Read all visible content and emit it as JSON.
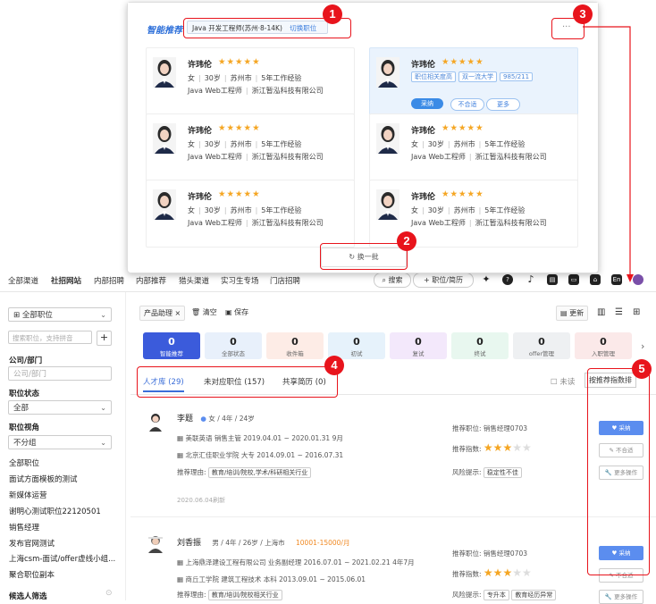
{
  "popup": {
    "brand": "智能推荐",
    "job_selector": "Java 开发工程师(苏州·8-14K)",
    "switch_job": "切换职位",
    "more": "···",
    "refresh": "换一批",
    "cards": [
      {
        "name": "许玮伦",
        "stars": "★★★★★",
        "line1": [
          "女",
          "30岁",
          "苏州市",
          "5年工作经验"
        ],
        "line2": [
          "Java Web工程师",
          "浙江暂泓科技有限公司"
        ]
      },
      {
        "name": "许玮伦",
        "stars": "★★★★★",
        "tags": [
          "职位相关度高",
          "双一流大学",
          "985/211"
        ],
        "actions": [
          "采纳",
          "不合适",
          "更多"
        ]
      },
      {
        "name": "许玮伦",
        "stars": "★★★★★",
        "line1": [
          "女",
          "30岁",
          "苏州市",
          "5年工作经验"
        ],
        "line2": [
          "Java Web工程师",
          "浙江暂泓科技有限公司"
        ]
      },
      {
        "name": "许玮伦",
        "stars": "★★★★★",
        "line1": [
          "女",
          "30岁",
          "苏州市",
          "5年工作经验"
        ],
        "line2": [
          "Java Web工程师",
          "浙江暂泓科技有限公司"
        ]
      },
      {
        "name": "许玮伦",
        "stars": "★★★★★",
        "line1": [
          "女",
          "30岁",
          "苏州市",
          "5年工作经验"
        ],
        "line2": [
          "Java Web工程师",
          "浙江暂泓科技有限公司"
        ]
      },
      {
        "name": "许玮伦",
        "stars": "★★★★★",
        "line1": [
          "女",
          "30岁",
          "苏州市",
          "5年工作经验"
        ],
        "line2": [
          "Java Web工程师",
          "浙江暂泓科技有限公司"
        ]
      }
    ]
  },
  "callouts": [
    "1",
    "2",
    "3",
    "4",
    "5"
  ],
  "nav": {
    "items": [
      "全部渠道",
      "社招网站",
      "内部招聘",
      "内部推荐",
      "猎头渠道",
      "实习生专场",
      "门店招聘"
    ],
    "search": "搜索",
    "post_job": "+ 职位/简历",
    "lang": "En"
  },
  "sidebar": {
    "all_jobs": "全部职位",
    "search_placeholder": "搜索职位，支持拼音",
    "plus": "+",
    "dept_label": "公司/部门",
    "dept_placeholder": "公司/部门",
    "status_label": "职位状态",
    "status_value": "全部",
    "view_label": "职位视角",
    "view_value": "不分组",
    "groups": [
      "全部职位",
      "面试方面模板的测试",
      "新媒体运营",
      "谢明心测试职位22120501",
      "销售经理",
      "发布官网测试",
      "上海csm-面试/offer虚线小组...",
      "聚合职位副本"
    ],
    "candidates_filter": "候选人筛选"
  },
  "toolbar": {
    "product_assistant": "产品助理",
    "clear": "清空",
    "save": "保存",
    "update": "更新"
  },
  "stats": [
    {
      "n": "0",
      "t": "智能推荐",
      "bg": "#3b5bdb",
      "fg": "#ffffff"
    },
    {
      "n": "0",
      "t": "全部状态",
      "bg": "#e8f0fb",
      "fg": "#222222"
    },
    {
      "n": "0",
      "t": "收件箱",
      "bg": "#fdece6",
      "fg": "#222222"
    },
    {
      "n": "0",
      "t": "初试",
      "bg": "#e6f2fb",
      "fg": "#222222"
    },
    {
      "n": "0",
      "t": "复试",
      "bg": "#f3e8fb",
      "fg": "#222222"
    },
    {
      "n": "0",
      "t": "终试",
      "bg": "#e8f7ef",
      "fg": "#222222"
    },
    {
      "n": "0",
      "t": "offer管理",
      "bg": "#eef0f2",
      "fg": "#222222"
    },
    {
      "n": "0",
      "t": "入职管理",
      "bg": "#fbe9e9",
      "fg": "#222222"
    }
  ],
  "tabs": [
    {
      "label": "人才库",
      "count": "(29)"
    },
    {
      "label": "未对应职位",
      "count": "(157)"
    },
    {
      "label": "共享简历",
      "count": "(0)"
    }
  ],
  "unread": "未读",
  "sort": "按推荐指数排",
  "candidates": [
    {
      "name": "李题",
      "meta": "女 / 4年 / 24岁",
      "work": "美联英语  销售主管  2019.04.01 ~ 2020.01.31  9月",
      "edu": "北京汇佳职业学院  大专  2014.09.01 ~ 2016.07.31",
      "reason_label": "推荐理由:",
      "reason": "教育/培训/院校,学术/科研相关行业",
      "date": "2020.06.04刷新",
      "job_label": "推荐职位:",
      "job": "销售经理0703",
      "idx_label": "推荐指数:",
      "risk_label": "风险提示:",
      "risk": [
        "稳定性不佳"
      ],
      "actions": [
        "采纳",
        "不合适",
        "更多操作"
      ]
    },
    {
      "name": "刘香振",
      "meta": "男 / 4年 / 26岁 / 上海市",
      "salary": "10001-15000/月",
      "work": "上海鼎泽建设工程有限公司  业务副经理  2016.07.01 ~ 2021.02.21  4年7月",
      "edu": "商丘工学院  建筑工程技术  本科  2013.09.01 ~ 2015.06.01",
      "reason_label": "推荐理由:",
      "reason": "教育/培训/院校相关行业",
      "job_label": "推荐职位:",
      "job": "销售经理0703",
      "idx_label": "推荐指数:",
      "risk_label": "风险提示:",
      "risk": [
        "专升本",
        "教育经历异常"
      ],
      "actions": [
        "采纳",
        "不合适",
        "更多操作"
      ]
    }
  ]
}
